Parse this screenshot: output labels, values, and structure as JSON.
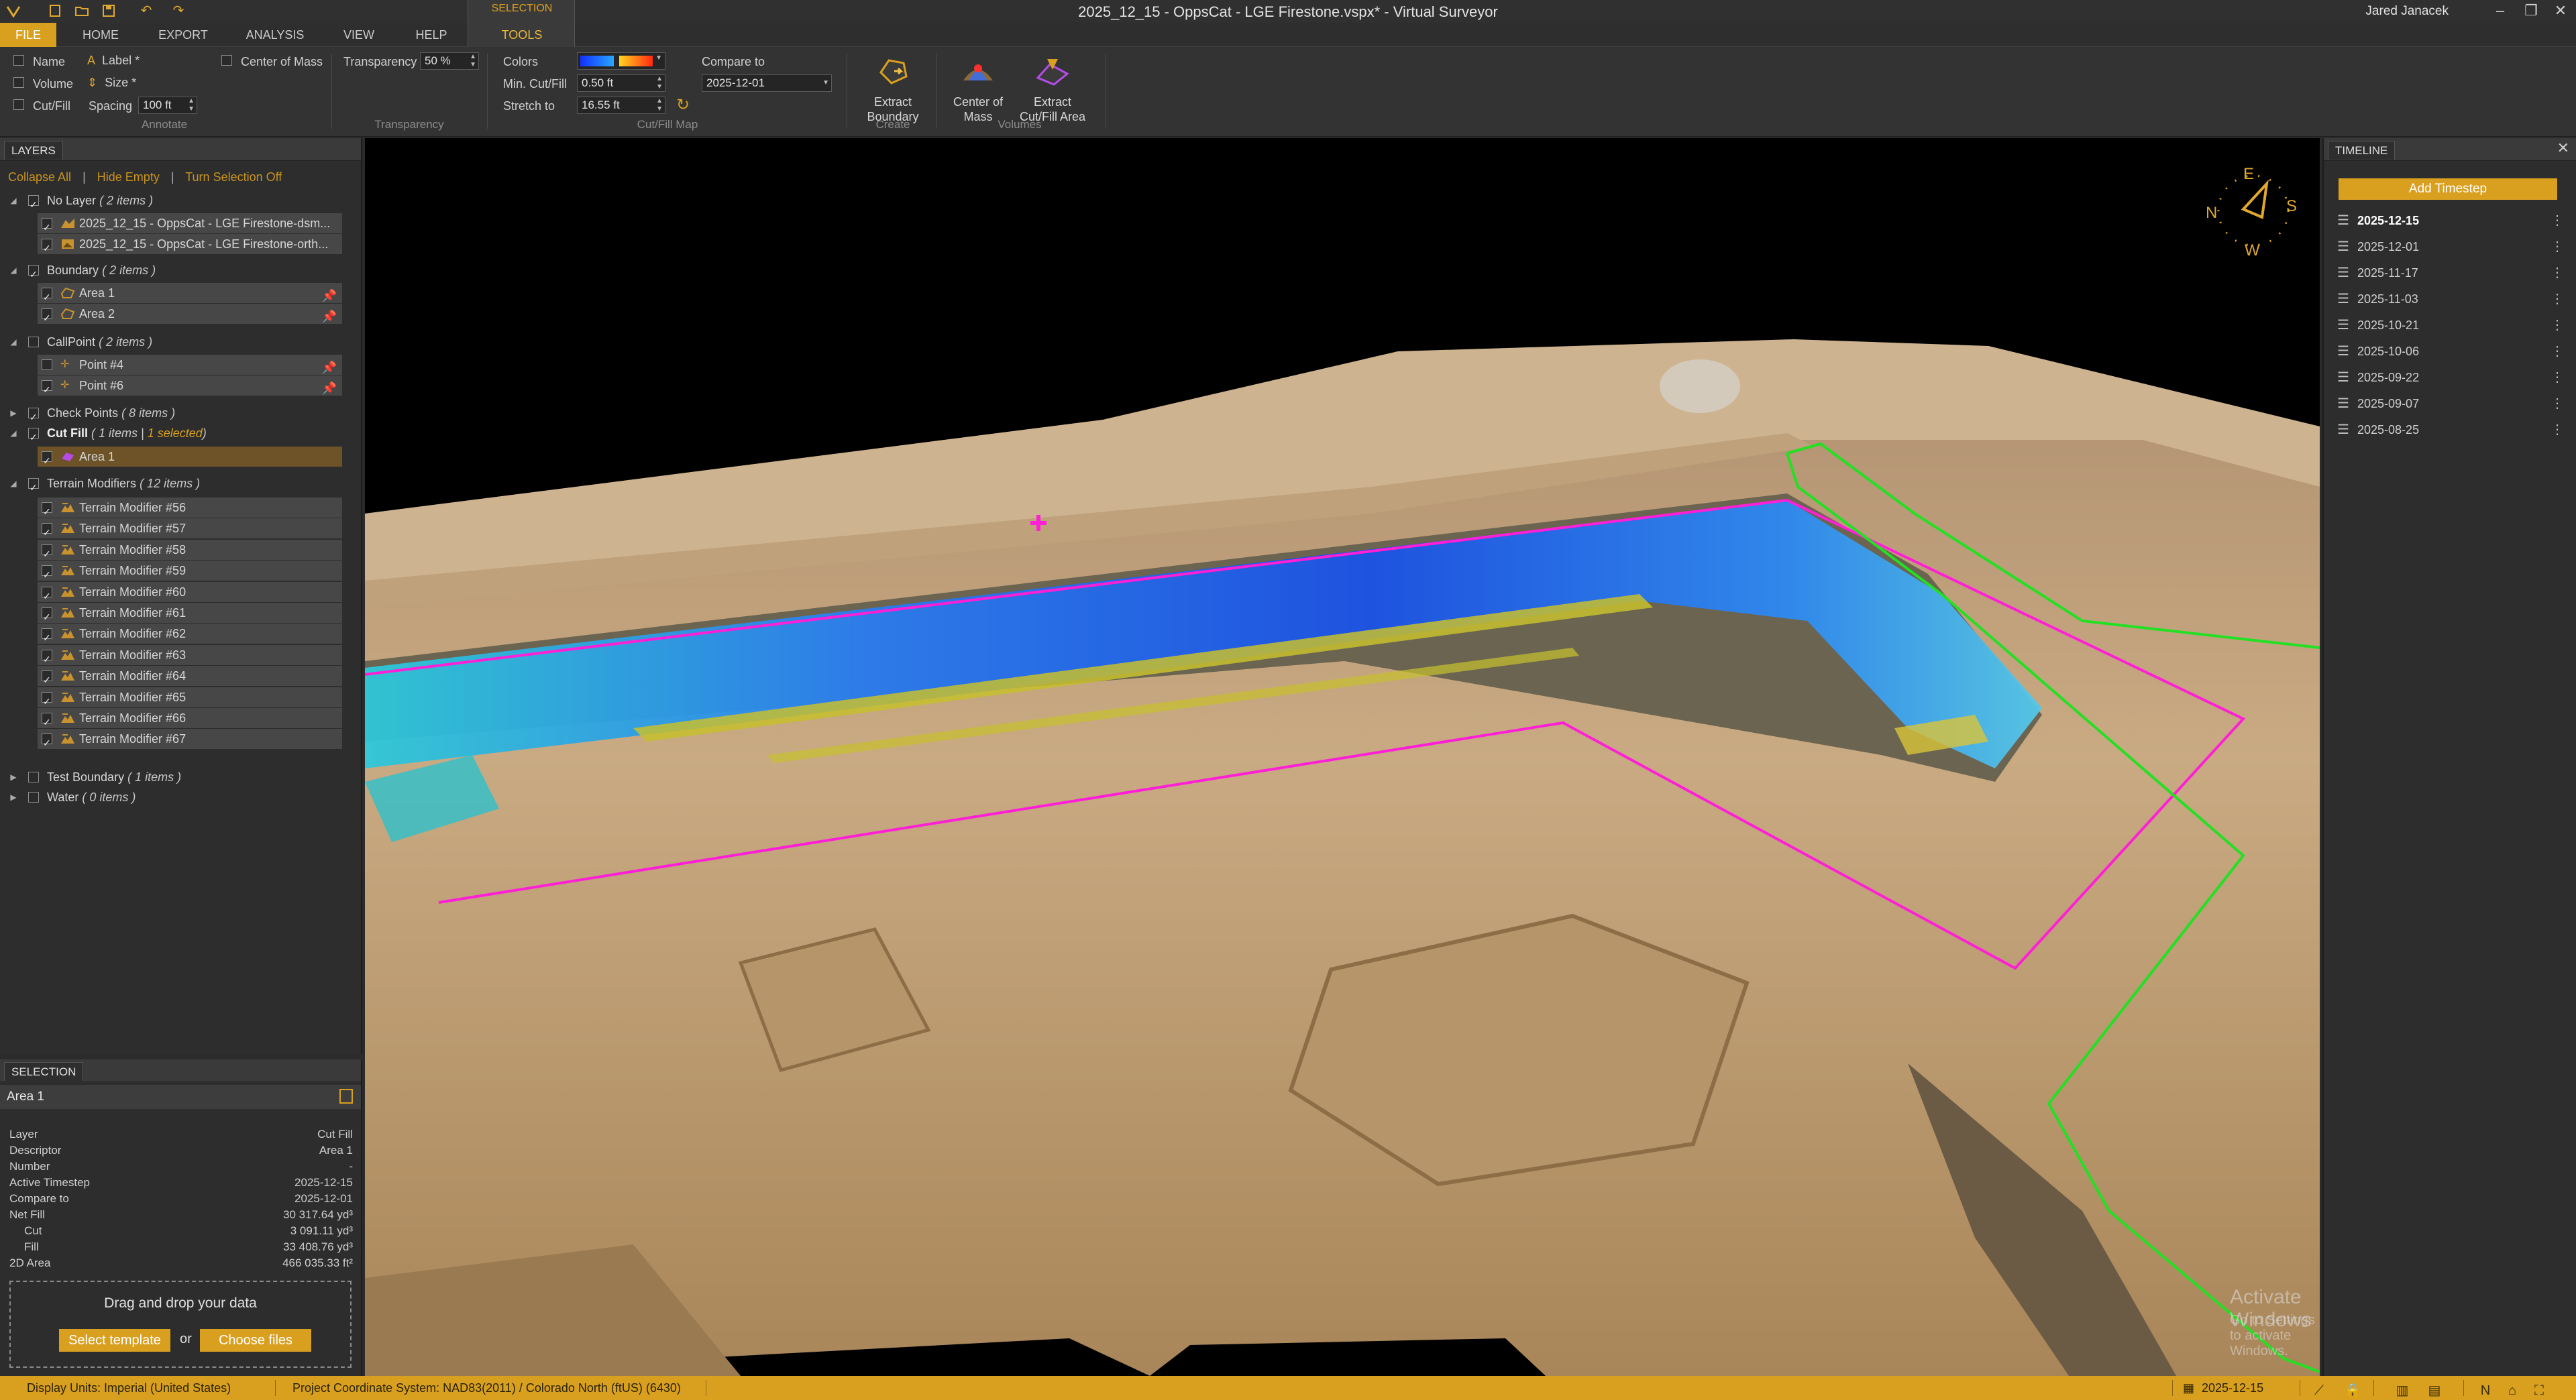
{
  "window": {
    "title": "2025_12_15 - OppsCat - LGE Firestone.vspx* - Virtual Surveyor",
    "user": "Jared Janacek",
    "controls": {
      "minimize": "–",
      "restore": "❐",
      "close": "✕"
    }
  },
  "quick_access": [
    "V",
    "▢",
    "⬚",
    "💾",
    "↶",
    "↷"
  ],
  "tabs": {
    "file": "FILE",
    "home": "HOME",
    "export": "EXPORT",
    "analysis": "ANALYSIS",
    "view": "VIEW",
    "help": "HELP",
    "context_group": "SELECTION",
    "tools": "TOOLS"
  },
  "ribbon": {
    "annotate": {
      "name": "Name",
      "volume": "Volume",
      "cutfill": "Cut/Fill",
      "label": "Label *",
      "size": "Size *",
      "spacing_label": "Spacing",
      "spacing_value": "100 ft",
      "center_of_mass": "Center of Mass",
      "group": "Annotate"
    },
    "transparency": {
      "label": "Transparency",
      "value": "50 %",
      "group": "Transparency"
    },
    "cutfill_map": {
      "colors": "Colors",
      "min_label": "Min. Cut/Fill",
      "min_value": "0.50 ft",
      "stretch_label": "Stretch to",
      "stretch_value": "16.55 ft",
      "compare_label": "Compare to",
      "compare_value": "2025-12-01",
      "group": "Cut/Fill Map"
    },
    "create": {
      "extract_boundary": "Extract Boundary",
      "group": "Create"
    },
    "volumes": {
      "center_of_mass": "Center of Mass",
      "extract_cutfill": "Extract Cut/Fill Area",
      "group": "Volumes"
    }
  },
  "layers": {
    "tab": "LAYERS",
    "links": {
      "collapse": "Collapse All",
      "hide_empty": "Hide Empty",
      "turn_off": "Turn Selection Off"
    },
    "groups": {
      "no_layer": {
        "name": "No Layer",
        "count": "( 2 items )",
        "items": [
          "2025_12_15 - OppsCat - LGE Firestone-dsm...",
          "2025_12_15 - OppsCat - LGE Firestone-orth..."
        ]
      },
      "boundary": {
        "name": "Boundary",
        "count": "( 2 items )",
        "items": [
          "Area 1",
          "Area 2"
        ]
      },
      "callpoint": {
        "name": "CallPoint",
        "count": "( 2 items )",
        "items": [
          "Point #4",
          "Point #6"
        ]
      },
      "check_points": {
        "name": "Check Points",
        "count": "( 8 items )"
      },
      "cut_fill": {
        "name": "Cut Fill",
        "count": "( 1 items |",
        "selected": "1 selected",
        "close": ")",
        "items": [
          "Area 1"
        ]
      },
      "terrain": {
        "name": "Terrain Modifiers",
        "count": "( 12 items )",
        "items": [
          "Terrain Modifier #56",
          "Terrain Modifier #57",
          "Terrain Modifier #58",
          "Terrain Modifier #59",
          "Terrain Modifier #60",
          "Terrain Modifier #61",
          "Terrain Modifier #62",
          "Terrain Modifier #63",
          "Terrain Modifier #64",
          "Terrain Modifier #65",
          "Terrain Modifier #66",
          "Terrain Modifier #67"
        ]
      },
      "test_boundary": {
        "name": "Test Boundary",
        "count": "( 1 items )"
      },
      "water": {
        "name": "Water",
        "count": "( 0 items )"
      }
    }
  },
  "selection": {
    "tab": "SELECTION",
    "title": "Area 1",
    "props": [
      {
        "k": "Layer",
        "v": "Cut Fill"
      },
      {
        "k": "Descriptor",
        "v": "Area 1"
      },
      {
        "k": "Number",
        "v": "-"
      },
      {
        "k": "Active Timestep",
        "v": "2025-12-15"
      },
      {
        "k": "Compare to",
        "v": "2025-12-01"
      },
      {
        "k": "Net Fill",
        "v": "30 317.64 yd³"
      },
      {
        "k": "Cut",
        "v": "3 091.11 yd³"
      },
      {
        "k": "Fill",
        "v": "33 408.76 yd³"
      },
      {
        "k": "2D Area",
        "v": "466 035.33 ft²"
      }
    ],
    "drop": {
      "text": "Drag and drop your data",
      "template": "Select template",
      "or": "or",
      "files": "Choose files"
    }
  },
  "viewport": {
    "compass": {
      "n": "N",
      "e": "E",
      "s": "S",
      "w": "W"
    },
    "watermark": {
      "line1": "Activate Windows",
      "line2": "Go to Settings to activate Windows."
    }
  },
  "timeline": {
    "tab": "TIMELINE",
    "add": "Add Timestep",
    "dates": [
      "2025-12-15",
      "2025-12-01",
      "2025-11-17",
      "2025-11-03",
      "2025-10-21",
      "2025-10-06",
      "2025-09-22",
      "2025-09-07",
      "2025-08-25"
    ]
  },
  "status": {
    "units": "Display Units:  Imperial (United States)",
    "crs": "Project Coordinate System:  NAD83(2011) / Colorado North (ftUS) (6430)",
    "date": "2025-12-15"
  },
  "colors": {
    "accent": "#d9a020",
    "boundary_magenta": "#ff1fd6",
    "boundary_green": "#22e022"
  }
}
